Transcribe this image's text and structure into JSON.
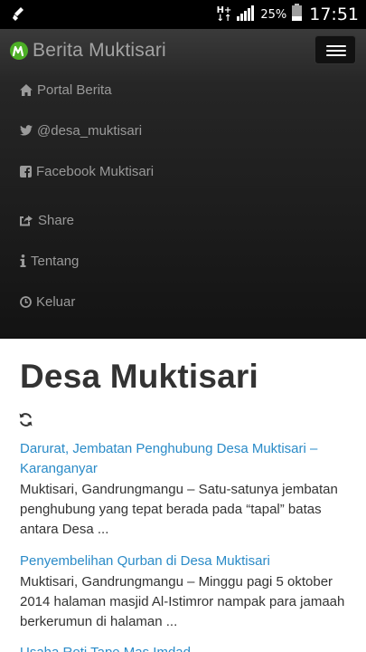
{
  "statusbar": {
    "network": "H+",
    "battery_percent": "25%",
    "time": "17:51"
  },
  "navbar": {
    "brand": "Berita Muktisari",
    "menu": [
      {
        "label": "Portal Berita",
        "icon": "home-icon"
      },
      {
        "label": "@desa_muktisari",
        "icon": "twitter-icon"
      },
      {
        "label": "Facebook Muktisari",
        "icon": "facebook-icon"
      },
      {
        "label": "Share",
        "icon": "share-icon"
      },
      {
        "label": "Tentang",
        "icon": "info-icon"
      },
      {
        "label": "Keluar",
        "icon": "clock-icon"
      }
    ]
  },
  "main": {
    "title": "Desa Muktisari",
    "articles": [
      {
        "title": "Darurat, Jembatan Penghubung Desa Muktisari – Karanganyar",
        "excerpt": "Muktisari, Gandrungmangu – Satu-satunya jembatan penghubung yang tepat berada pada “tapal” batas antara Desa ..."
      },
      {
        "title": "Penyembelihan Qurban di Desa Muktisari",
        "excerpt": "Muktisari, Gandrungmangu – Minggu pagi 5 oktober 2014 halaman masjid Al-Istimror nampak para jamaah berkerumun di halaman ..."
      },
      {
        "title": "Usaha Roti Tape Mas Imdad",
        "excerpt": ""
      }
    ]
  },
  "colors": {
    "link": "#2a8bc8",
    "navbar": "#222222",
    "menu_text": "#9a9a9a",
    "brand_logo": "#4caf26"
  }
}
